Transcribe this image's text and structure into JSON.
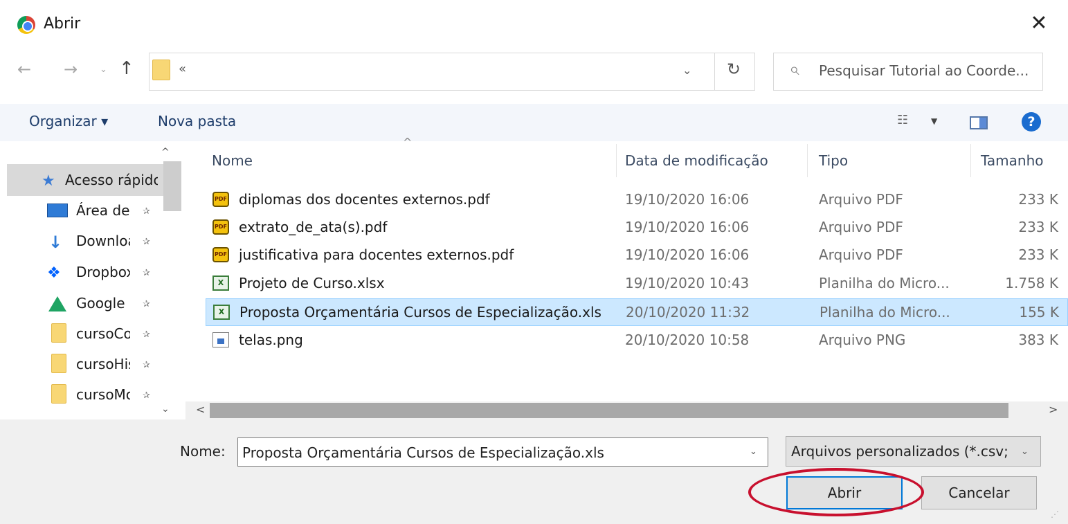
{
  "window": {
    "title": "Abrir",
    "close_glyph": "✕",
    "app_icon": "chrome-icon"
  },
  "address": {
    "back_glyph": "←",
    "forward_glyph": "→",
    "recent_glyph": "⌄",
    "up_glyph": "↑",
    "path_text": "«",
    "dropdown_glyph": "⌄",
    "refresh_glyph": "↻",
    "search_glyph": "⌕",
    "search_placeholder": "Pesquisar Tutorial ao Coorde..."
  },
  "toolbar": {
    "organize_label": "Organizar ▾",
    "new_folder_label": "Nova pasta",
    "view_glyph": "☷",
    "view_drop_glyph": "▼",
    "help_glyph": "?"
  },
  "nav": {
    "scroll_up": "^",
    "scroll_down": "⌄",
    "items": [
      {
        "label": "Acesso rápido",
        "icon": "star-icon"
      },
      {
        "label": "Área de ",
        "icon": "desktop-icon"
      },
      {
        "label": "Downloa",
        "icon": "download-icon"
      },
      {
        "label": "Dropbox",
        "icon": "dropbox-icon"
      },
      {
        "label": "Google D",
        "icon": "google-drive-icon"
      },
      {
        "label": "cursoCoı",
        "icon": "folder-icon"
      },
      {
        "label": "cursoHis",
        "icon": "folder-icon"
      },
      {
        "label": "cursoMo",
        "icon": "folder-icon"
      }
    ],
    "pin_glyph": "✰"
  },
  "columns": {
    "name": "Nome",
    "modified": "Data de modificação",
    "type": "Tipo",
    "size": "Tamanho",
    "sort_glyph": "^"
  },
  "files": [
    {
      "name": "diplomas dos docentes externos.pdf",
      "modified": "19/10/2020 16:06",
      "type": "Arquivo PDF",
      "size": "233 K",
      "icon": "pdf-icon",
      "icon_text": "PDF"
    },
    {
      "name": "extrato_de_ata(s).pdf",
      "modified": "19/10/2020 16:06",
      "type": "Arquivo PDF",
      "size": "233 K",
      "icon": "pdf-icon",
      "icon_text": "PDF"
    },
    {
      "name": "justificativa para docentes externos.pdf",
      "modified": "19/10/2020 16:06",
      "type": "Arquivo PDF",
      "size": "233 K",
      "icon": "pdf-icon",
      "icon_text": "PDF"
    },
    {
      "name": "Projeto de Curso.xlsx",
      "modified": "19/10/2020 10:43",
      "type": "Planilha do Micro...",
      "size": "1.758 K",
      "icon": "excel-icon",
      "icon_text": "X"
    },
    {
      "name": "Proposta Orçamentária Cursos de Especialização.xls",
      "modified": "20/10/2020 11:32",
      "type": "Planilha do Micro...",
      "size": "155 K",
      "icon": "excel-icon",
      "icon_text": "X",
      "selected": true
    },
    {
      "name": "telas.png",
      "modified": "20/10/2020 10:58",
      "type": "Arquivo PNG",
      "size": "383 K",
      "icon": "image-icon",
      "icon_text": ""
    }
  ],
  "scroll": {
    "left_glyph": "<",
    "right_glyph": ">"
  },
  "bottom": {
    "filename_label": "Nome:",
    "filename_value": "Proposta Orçamentária Cursos de Especialização.xls",
    "filename_drop": "⌄",
    "filetype_value": "Arquivos personalizados (*.csv;",
    "filetype_drop": "⌄",
    "open_label": "Abrir",
    "cancel_label": "Cancelar",
    "resize_glyph": "⋰"
  },
  "colors": {
    "highlight": "#c8102e",
    "selection": "#cce8ff",
    "accent": "#0078d7"
  }
}
